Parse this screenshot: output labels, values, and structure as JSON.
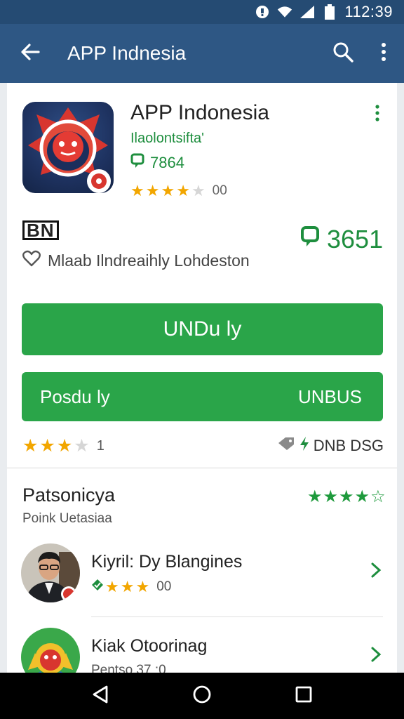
{
  "status_bar": {
    "time": "112:39",
    "icons": [
      "notification-icon",
      "wifi-icon",
      "signal-icon",
      "battery-icon"
    ]
  },
  "app_bar": {
    "title": "APP Indnesia",
    "icons": [
      "back-arrow-icon",
      "search-icon",
      "more-vert-icon"
    ]
  },
  "app": {
    "name": "APP Indonesia",
    "developer": "Ilaolontsifta'",
    "count": "7864",
    "rating_text": "00",
    "rating_stars": 4,
    "badge": "BN",
    "big_count": "3651",
    "wishlist_label": "Mlaab Ilndreaihly Lohdeston"
  },
  "buttons": {
    "install": "UNDu ly",
    "second_left": "Posdu ly",
    "second_right": "UNBUS"
  },
  "meta": {
    "rating_stars": 3,
    "rating_count": "1",
    "right_text": "DNB DSG"
  },
  "section": {
    "title": "Patsonicya",
    "subtitle": "Poink Uetasiaa",
    "stars": 4
  },
  "list": [
    {
      "title": "Kiyril: Dy Blangines",
      "meta": "00",
      "stars": 3
    },
    {
      "title": "Kiak Otoorinag",
      "meta": "Pentso 37 :0"
    }
  ],
  "colors": {
    "app_bar": "#2e5784",
    "status_bar": "#254b73",
    "accent_green": "#2aa549",
    "text_green": "#1e8e3e",
    "star_gold": "#f2a600"
  }
}
